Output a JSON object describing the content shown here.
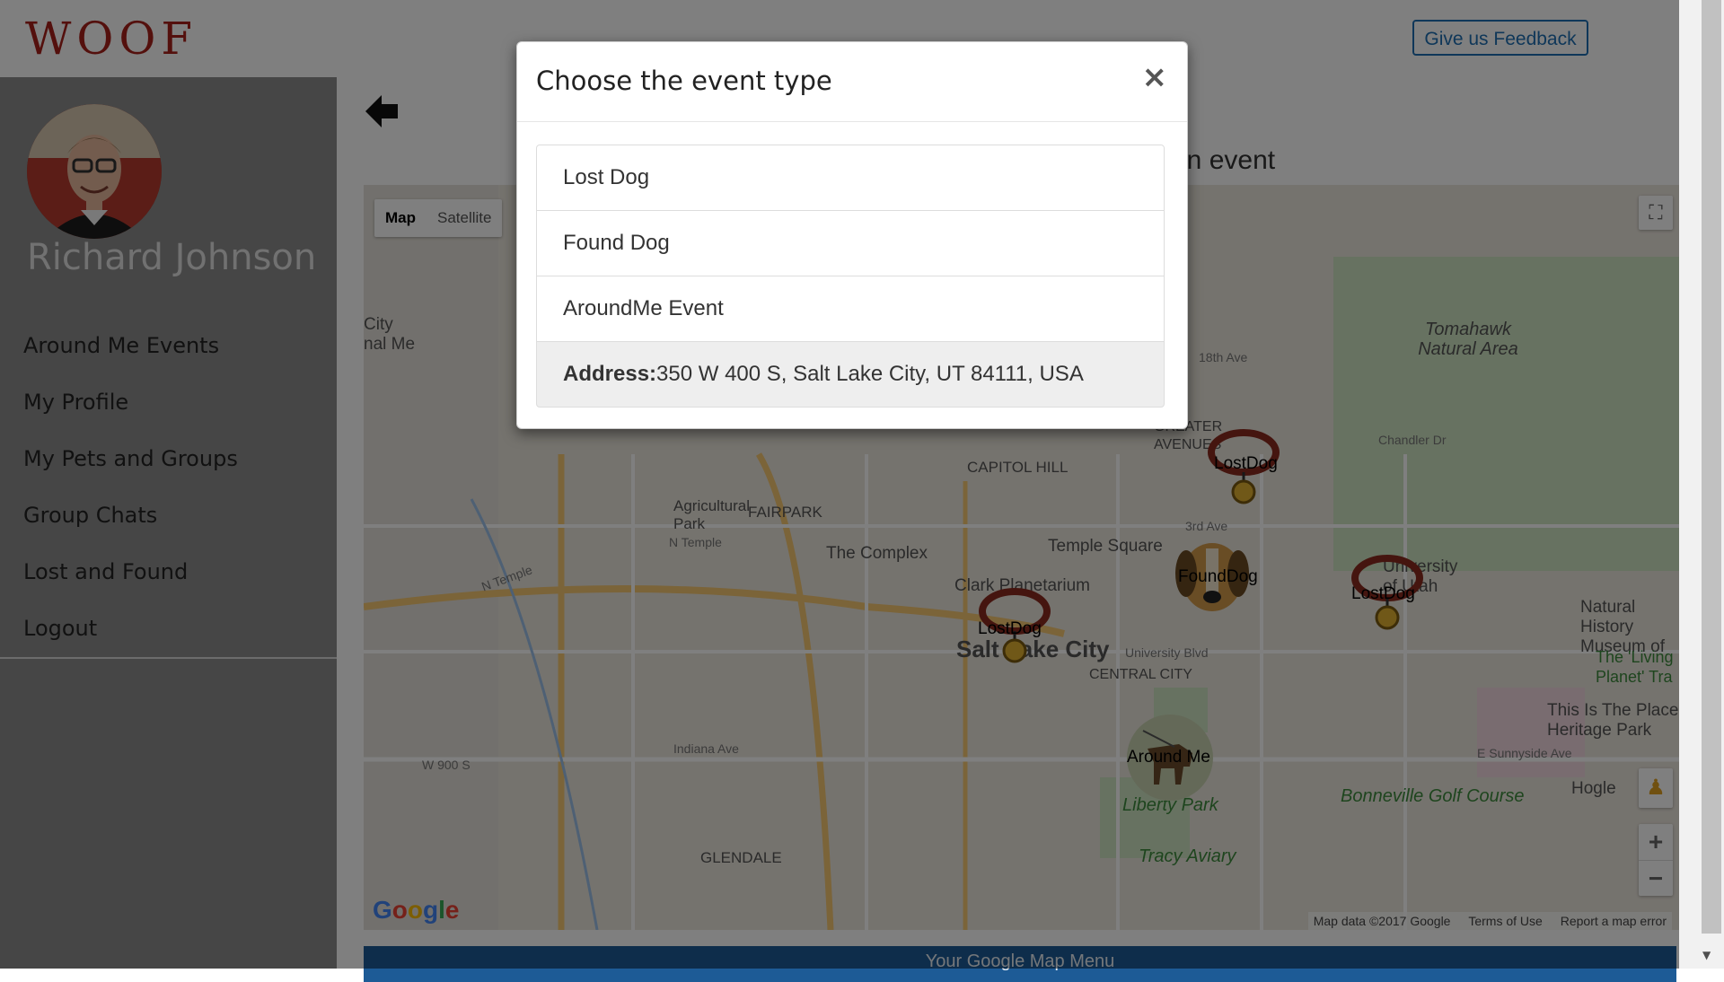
{
  "header": {
    "logo": "WOOF",
    "feedback_button": "Give us Feedback"
  },
  "sidebar": {
    "username": "Richard Johnson",
    "items": [
      {
        "label": "Around Me Events"
      },
      {
        "label": "My Profile"
      },
      {
        "label": "My Pets and Groups"
      },
      {
        "label": "Group Chats"
      },
      {
        "label": "Lost and Found"
      },
      {
        "label": "Logout"
      }
    ]
  },
  "main": {
    "heading_visible": "an event",
    "map": {
      "type_buttons": {
        "map": "Map",
        "satellite": "Satellite"
      },
      "labels": {
        "salt_lake_city": "Salt Lake City",
        "capitol_hill": "CAPITOL HILL",
        "fairpark": "FAIRPARK",
        "agricultural_park": "Agricultural Park",
        "n_temple_1": "N Temple",
        "n_temple_2": "N Temple",
        "the_complex": "The Complex",
        "clark_planetarium": "Clark Planetarium",
        "temple_square": "Temple Square",
        "university_blvd": "University Blvd",
        "central_city": "CENTRAL CITY",
        "liberty_park": "Liberty Park",
        "tracy_aviary": "Tracy Aviary",
        "tomahawk_natural_area": "Tomahawk Natural Area",
        "greater_avenues": "GREATER AVENUES",
        "natural_history_museum": "Natural History Museum of",
        "the_living": "The 'Living Planet' Tra",
        "this_is_the_place": "This Is The Place Heritage Park",
        "bonneville_golf": "Bonneville Golf Course",
        "hogle": "Hogle",
        "glendale": "GLENDALE",
        "indiana_ave": "Indiana Ave",
        "w_900_s": "W 900 S",
        "city_nal_me": "City nal Me",
        "university_of_utah": "University of Utah",
        "third_ave": "3rd Ave",
        "eighteenth_ave": "18th Ave",
        "chandler_dr": "Chandler Dr",
        "e_sunnyside_ave": "E Sunnyside Ave"
      },
      "markers": [
        {
          "type": "lost",
          "label": "LostDog"
        },
        {
          "type": "found",
          "label": "FoundDog"
        },
        {
          "type": "lost",
          "label": "LostDog"
        },
        {
          "type": "lost",
          "label": "LostDog"
        },
        {
          "type": "around",
          "label": "Around Me"
        }
      ],
      "google_logo": "Google",
      "attribution": {
        "data": "Map data ©2017 Google",
        "terms": "Terms of Use",
        "report": "Report a map error"
      },
      "zoom_in": "+",
      "zoom_out": "−"
    },
    "menu_bar": "Your Google Map Menu"
  },
  "modal": {
    "title": "Choose the event type",
    "close": "×",
    "options": [
      {
        "label": "Lost Dog"
      },
      {
        "label": "Found Dog"
      },
      {
        "label": "AroundMe Event"
      }
    ],
    "address_label": "Address:",
    "address_value": "350 W 400 S, Salt Lake City, UT 84111, USA"
  },
  "colors": {
    "brand": "#a8201a",
    "accent": "#1f6fb2",
    "sidebar_bg": "#8c8c8c",
    "map_menu": "#1d5b96"
  }
}
